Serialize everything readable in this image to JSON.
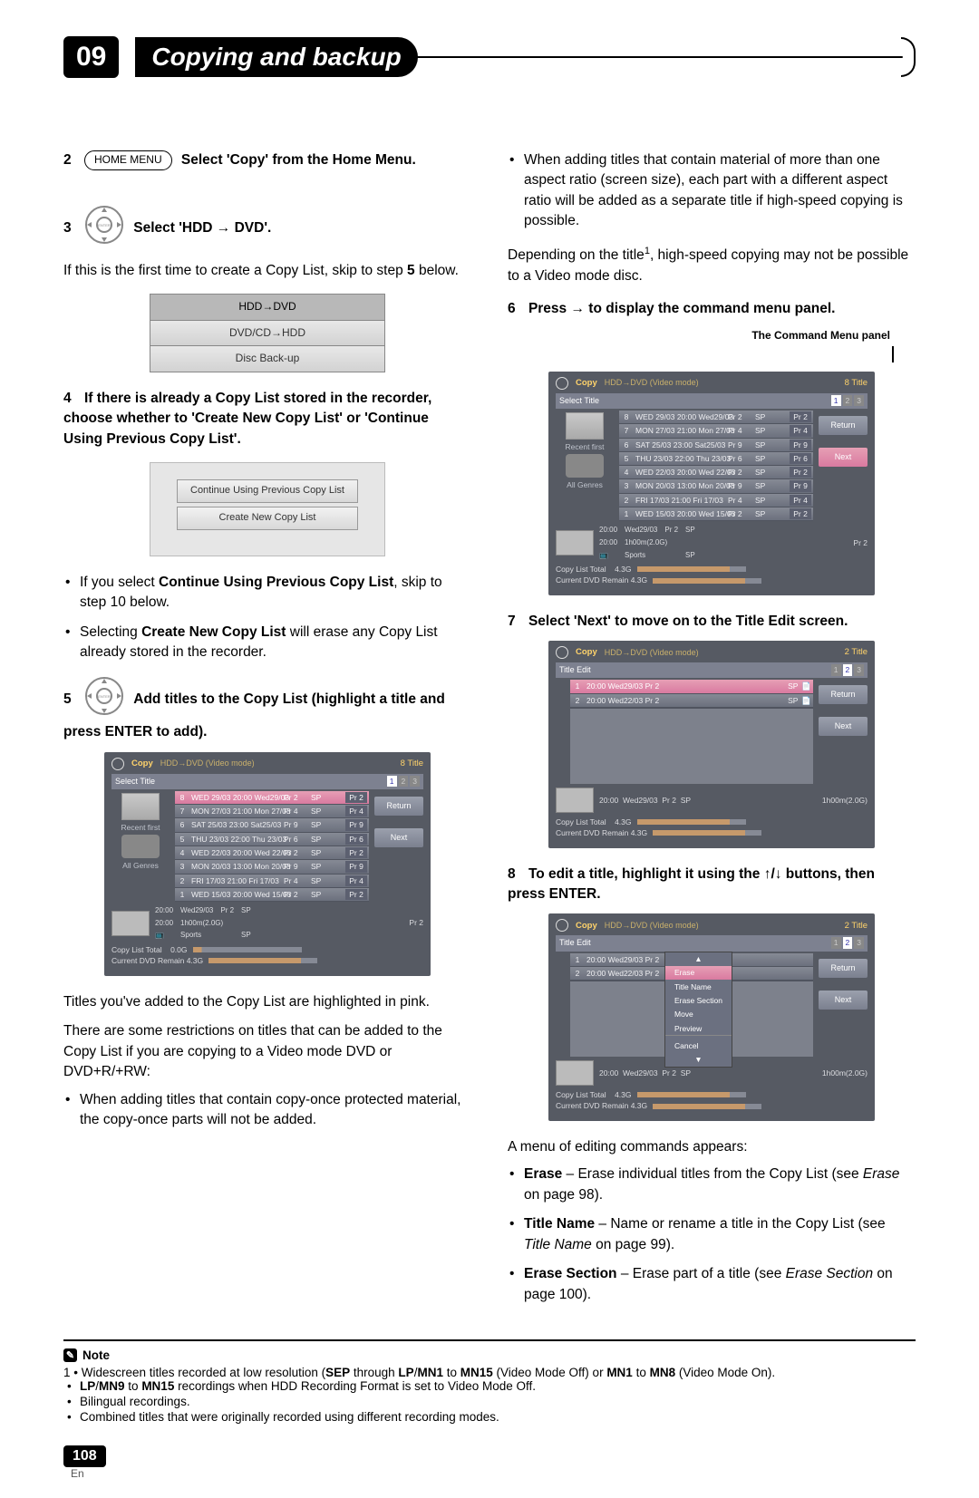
{
  "chapter": {
    "number": "09",
    "title": "Copying and backup"
  },
  "left": {
    "step2": {
      "num": "2",
      "btn": "HOME MENU",
      "text": "Select 'Copy' from the Home Menu."
    },
    "step3": {
      "num": "3",
      "text": "Select 'HDD → DVD'."
    },
    "step3_after": "If this is the first time to create a Copy List, skip to step ",
    "step3_after_b": "5",
    "step3_after2": " below.",
    "menu": {
      "r1": "HDD→DVD",
      "r2": "DVD/CD→HDD",
      "r3": "Disc Back-up"
    },
    "step4": {
      "num": "4",
      "text": "If there is already a Copy List stored in the recorder, choose whether to 'Create New Copy List' or 'Continue Using Previous Copy List'."
    },
    "dialog": {
      "b1": "Continue Using Previous Copy List",
      "b2": "Create New Copy List"
    },
    "bul1_a": "If you select ",
    "bul1_b": "Continue Using Previous Copy List",
    "bul1_c": ", skip to step 10 below.",
    "bul2_a": "Selecting ",
    "bul2_b": "Create New Copy List",
    "bul2_c": " will erase any Copy List already stored in the recorder.",
    "step5": {
      "num": "5",
      "text": "Add titles to the Copy List (highlight a title and press ENTER to add)."
    },
    "after_titles_1": "Titles you've added to the Copy List are highlighted in pink.",
    "after_titles_2": "There are some restrictions on titles that can be added to the Copy List if you are copying to a Video mode DVD or DVD+R/+RW:",
    "bul3": "When adding titles that contain copy-once protected material, the copy-once parts will not be added."
  },
  "right": {
    "bul_top": "When adding titles that contain material of more than one aspect ratio (screen size), each part with a different aspect ratio will be added as a separate title if high-speed copying is possible.",
    "depend_a": "Depending on the title",
    "depend_sup": "1",
    "depend_b": ", high-speed copying may not be possible to a Video mode disc.",
    "step6": {
      "num": "6",
      "text_a": "Press ",
      "arrow": "→",
      "text_b": " to display the command menu panel."
    },
    "cmd_label": "The Command Menu panel",
    "step7": {
      "num": "7",
      "text": "Select 'Next' to move on to the Title Edit screen."
    },
    "step8": {
      "num": "8",
      "text_a": "To edit a title, highlight it using the ",
      "arrows": "↑/↓",
      "text_b": " buttons, then press ENTER."
    },
    "menu_appears": "A menu of editing commands appears:",
    "ed1_a": "Erase",
    "ed1_b": " – Erase individual titles from the Copy List (see ",
    "ed1_c": "Erase",
    "ed1_d": " on page 98).",
    "ed2_a": "Title Name",
    "ed2_b": " – Name or rename a title in the Copy List (see ",
    "ed2_c": "Title Name",
    "ed2_d": " on page 99).",
    "ed3_a": "Erase Section",
    "ed3_b": " – Erase part of a title (see ",
    "ed3_c": "Erase Section",
    "ed3_d": " on page 100)."
  },
  "osd": {
    "copy": "Copy",
    "mode": "HDD→DVD (Video mode)",
    "side_8": "8  Title",
    "side_2": "2  Title",
    "select_title": "Select Title",
    "title_edit": "Title Edit",
    "pg1": "1",
    "pg2": "2",
    "pg3": "3",
    "recent": "Recent first",
    "genres": "All Genres",
    "return": "Return",
    "next": "Next",
    "clt": "Copy List Total",
    "cdr": "Current DVD Remain",
    "size0": "0.0G",
    "size43": "4.3G",
    "prev_time": "20:00",
    "prev_date": "Wed29/03",
    "prev_pr": "Pr 2",
    "prev_sp": "SP",
    "prev_dur": "1h00m(2.0G)",
    "prev_genre_icon": "📺",
    "prev_genre": "Sports",
    "rows": [
      {
        "n": "8",
        "d": "WED 29/03 20:00 Wed29/03",
        "pr": "Pr 2",
        "q": "SP",
        "g": "Pr 2"
      },
      {
        "n": "7",
        "d": "MON 27/03 21:00 Mon 27/03",
        "pr": "Pr 4",
        "q": "SP",
        "g": "Pr 4"
      },
      {
        "n": "6",
        "d": "SAT 25/03 23:00 Sat25/03",
        "pr": "Pr 9",
        "q": "SP",
        "g": "Pr 9"
      },
      {
        "n": "5",
        "d": "THU 23/03 22:00 Thu 23/03",
        "pr": "Pr 6",
        "q": "SP",
        "g": "Pr 6"
      },
      {
        "n": "4",
        "d": "WED 22/03 20:00 Wed 22/03",
        "pr": "Pr 2",
        "q": "SP",
        "g": "Pr 2"
      },
      {
        "n": "3",
        "d": "MON 20/03 13:00 Mon 20/03",
        "pr": "Pr 9",
        "q": "SP",
        "g": "Pr 9"
      },
      {
        "n": "2",
        "d": "FRI 17/03 21:00 Fri 17/03",
        "pr": "Pr 4",
        "q": "SP",
        "g": "Pr 4"
      },
      {
        "n": "1",
        "d": "WED 15/03 20:00 Wed 15/03",
        "pr": "Pr 2",
        "q": "SP",
        "g": "Pr 2"
      }
    ],
    "te_rows": [
      {
        "n": "1",
        "d": "20:00 Wed29/03 Pr 2",
        "sp": "SP"
      },
      {
        "n": "2",
        "d": "20:00 Wed22/03 Pr 2",
        "sp": "SP"
      }
    ],
    "ctx": {
      "erase": "Erase",
      "tname": "Title Name",
      "esec": "Erase Section",
      "move": "Move",
      "preview": "Preview",
      "cancel": "Cancel"
    }
  },
  "note": {
    "head": "Note",
    "n1_a": "1 • Widescreen titles recorded at low resolution (",
    "n1_b": "SEP",
    "n1_c": " through ",
    "n1_d": "LP",
    "n1_e": "/",
    "n1_f": "MN1",
    "n1_g": " to ",
    "n1_h": "MN15",
    "n1_i": " (Video Mode Off) or ",
    "n1_j": "MN1",
    "n1_k": " to ",
    "n1_l": "MN8",
    "n1_m": " (Video Mode On).",
    "n2_a": "LP",
    "n2_b": "/",
    "n2_c": "MN9",
    "n2_d": " to ",
    "n2_e": "MN15",
    "n2_f": " recordings when HDD Recording Format is set to Video Mode Off.",
    "n3": "Bilingual recordings.",
    "n4": "Combined titles that were originally recorded using different recording modes."
  },
  "foot": {
    "page": "108",
    "lang": "En"
  }
}
